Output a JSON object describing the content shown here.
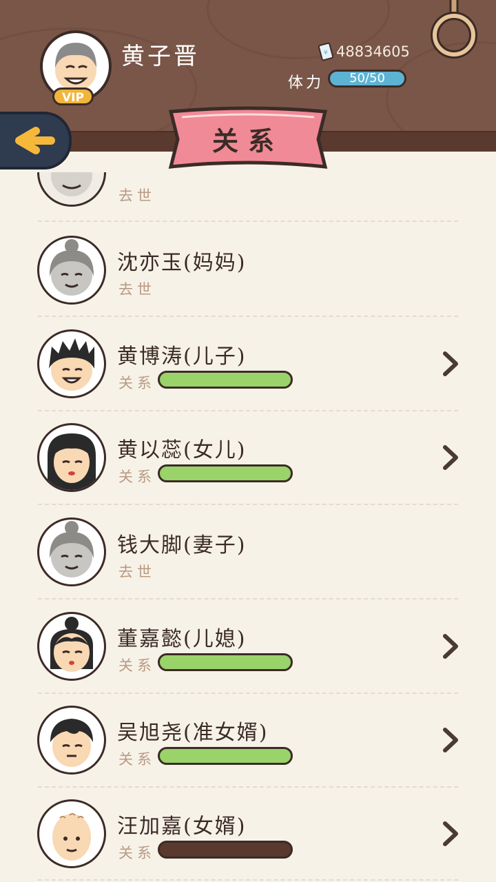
{
  "player": {
    "name": "黄子晋",
    "vip_label": "VIP",
    "money": "48834605",
    "stamina_label": "体力",
    "stamina_value": "50/50"
  },
  "page": {
    "title": "关系"
  },
  "relation_label": "关系",
  "deceased_label": "去世",
  "colors": {
    "relation_good": "#9ad36a",
    "relation_bad": "#5a3a2e",
    "stamina": "#5db3d2"
  },
  "people": [
    {
      "name": "沈亦玉(妈妈)",
      "status": "deceased",
      "sub": "去世"
    },
    {
      "name": "黄博涛(儿子)",
      "status": "alive",
      "sub": "关系",
      "relation": 1.0,
      "face": "spiky-hair-boy"
    },
    {
      "name": "黄以蕊(女儿)",
      "status": "alive",
      "sub": "关系",
      "relation": 1.0,
      "face": "long-hair-girl"
    },
    {
      "name": "钱大脚(妻子)",
      "status": "deceased",
      "sub": "去世"
    },
    {
      "name": "董嘉懿(儿媳)",
      "status": "alive",
      "sub": "关系",
      "relation": 1.0,
      "face": "bun-hair-woman"
    },
    {
      "name": "吴旭尧(准女婿)",
      "status": "alive",
      "sub": "关系",
      "relation": 1.0,
      "face": "short-hair-man"
    },
    {
      "name": "汪加嘉(女婿)",
      "status": "alive",
      "sub": "关系",
      "relation": 0.0,
      "face": "bald-man"
    }
  ]
}
